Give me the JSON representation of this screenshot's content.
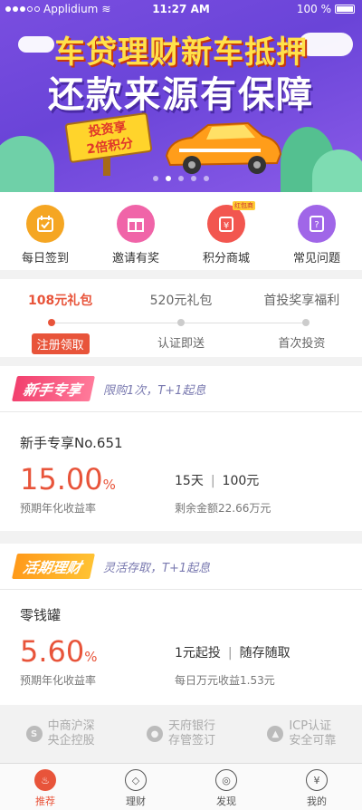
{
  "status_bar": {
    "carrier": "Applidium",
    "time": "11:27 AM",
    "battery": "100 %"
  },
  "banner": {
    "line1": "车贷理财新车抵押",
    "line2": "还款来源有保障",
    "sign_line1": "投资享",
    "sign_line2": "2倍积分",
    "slide_count": 5,
    "active_slide": 1
  },
  "quick_menu": [
    {
      "label": "每日签到",
      "icon": "calendar-check-icon",
      "color": "#f5a623"
    },
    {
      "label": "邀请有奖",
      "icon": "gift-icon",
      "color": "#f064a8"
    },
    {
      "label": "积分商城",
      "icon": "coin-bag-icon",
      "color": "#f2564f",
      "badge": "红包商"
    },
    {
      "label": "常见问题",
      "icon": "question-icon",
      "color": "#a066e8"
    }
  ],
  "gifts": {
    "tabs": [
      "108元礼包",
      "520元礼包",
      "首投奖享福利"
    ],
    "actions": [
      "注册领取",
      "认证即送",
      "首次投资"
    ],
    "active": 0
  },
  "newbie": {
    "ribbon": "新手专享",
    "subtitle": "限购1次，T+1起息",
    "name": "新手专享No.651",
    "rate": "15.00",
    "rate_unit": "%",
    "rate_label": "预期年化收益率",
    "term": "15天",
    "min_invest": "100元",
    "remain": "剩余金额22.66万元"
  },
  "current": {
    "ribbon": "活期理财",
    "subtitle": "灵活存取，T+1起息",
    "name": "零钱罐",
    "rate": "5.60",
    "rate_unit": "%",
    "rate_label": "预期年化收益率",
    "min_invest": "1元起投",
    "feature": "随存随取",
    "daily": "每日万元收益1.53元"
  },
  "trust": [
    {
      "line1": "中商沪深",
      "line2": "央企控股",
      "icon": "shield-sp-icon"
    },
    {
      "line1": "天府银行",
      "line2": "存管签订",
      "icon": "panda-icon"
    },
    {
      "line1": "ICP认证",
      "line2": "安全可靠",
      "icon": "icp-shield-icon"
    }
  ],
  "tabbar": [
    {
      "label": "推荐",
      "icon": "flame-icon"
    },
    {
      "label": "理财",
      "icon": "wallet-icon"
    },
    {
      "label": "发现",
      "icon": "compass-icon"
    },
    {
      "label": "我的",
      "icon": "user-yen-icon"
    }
  ],
  "tabbar_active": 0
}
